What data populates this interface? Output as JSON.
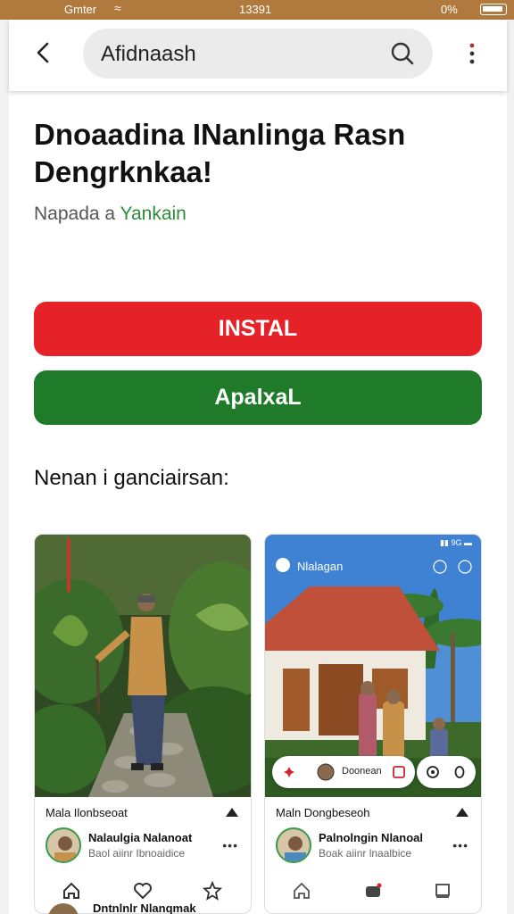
{
  "status_bar": {
    "carrier": "Gmter",
    "time": "13391",
    "battery": "0%"
  },
  "app_bar": {
    "search_text": "Afidnaash"
  },
  "app": {
    "title": "Dnoaadina INanlinga Rasn Dengrknkaa!",
    "subtitle_prefix": "Napada a ",
    "subtitle_accent": "Yankain"
  },
  "buttons": {
    "install": "INSTAL",
    "open": "ApalxaL"
  },
  "section": {
    "label": "Nenan i ganciairsan:"
  },
  "cards": [
    {
      "caption": "Mala Ilonbseoat",
      "name": "Nalaulgia Nalanoat",
      "sub": "Baol aiinr Ibnoaidice",
      "more": "•••"
    },
    {
      "caption": "Maln Dongbeseoh",
      "name": "Palnolngin Nlanoal",
      "sub": "Boak aiinr lnaalbice",
      "more": "•••",
      "photo_header": "Nlalagan",
      "overlay_text": "Doonean",
      "status": "▮▮ 9G ▬"
    }
  ],
  "next_row": {
    "name": "Dntnlnlr Nlanqmak"
  },
  "colors": {
    "install": "#e62229",
    "open": "#1f7a2a",
    "status_bar": "#b07a3e"
  }
}
